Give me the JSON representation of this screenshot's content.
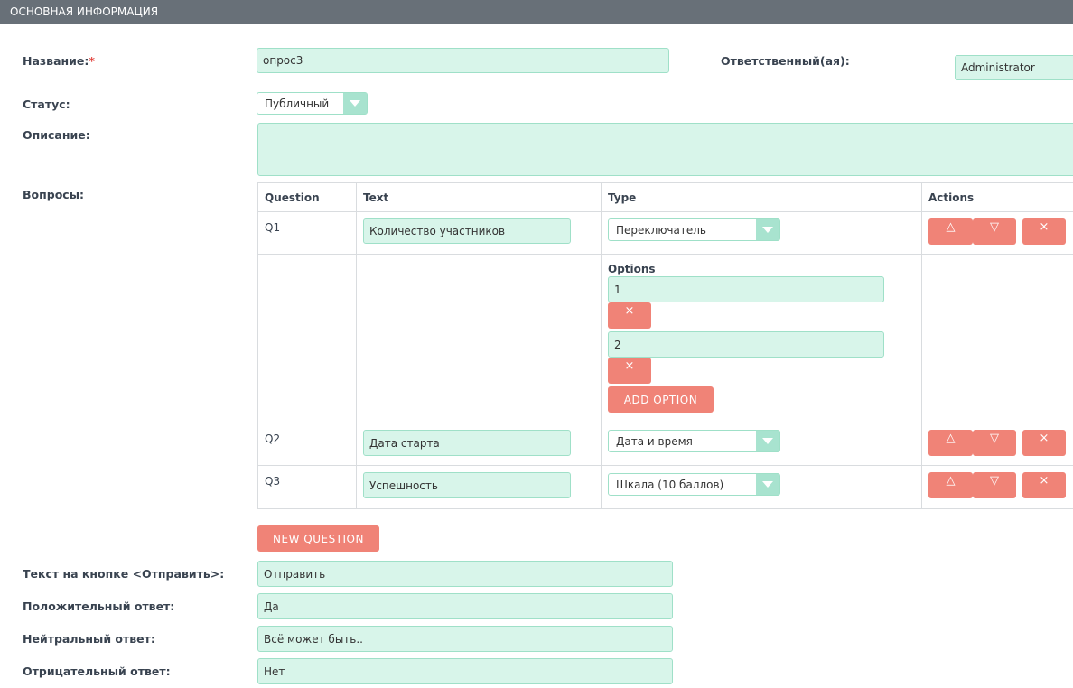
{
  "header": {
    "title": "ОСНОВНАЯ ИНФОРМАЦИЯ"
  },
  "form": {
    "name_label": "Название:",
    "required_mark": "*",
    "name_value": "опрос3",
    "assigned_label": "Ответственный(ая):",
    "assigned_value": "Administrator",
    "status_label": "Статус:",
    "status_value": "Публичный",
    "description_label": "Описание:",
    "description_value": "",
    "questions_label": "Вопросы:"
  },
  "questions_table": {
    "headers": {
      "question": "Question",
      "text": "Text",
      "type": "Type",
      "actions": "Actions"
    },
    "rows": [
      {
        "id": "Q1",
        "text": "Количество участников",
        "type": "Переключатель"
      },
      {
        "id": "Q2",
        "text": "Дата старта",
        "type": "Дата и время"
      },
      {
        "id": "Q3",
        "text": "Успешность",
        "type": "Шкала (10 баллов)"
      }
    ],
    "options_label": "Options",
    "options": [
      "1",
      "2"
    ],
    "add_option_label": "ADD OPTION",
    "action_icons": {
      "up": "△",
      "down": "▽",
      "remove": "×"
    }
  },
  "new_question_label": "NEW QUESTION",
  "extra": {
    "submit_label": "Текст на кнопке <Отправить>:",
    "submit_value": "Отправить",
    "positive_label": "Положительный ответ:",
    "positive_value": "Да",
    "neutral_label": "Нейтральный ответ:",
    "neutral_value": "Всё может быть..",
    "negative_label": "Отрицательный ответ:",
    "negative_value": "Нет"
  },
  "colors": {
    "header_bg": "#687078",
    "input_bg": "#d8f5ea",
    "input_border": "#9fe0c8",
    "button_red": "#f08377",
    "required": "#e2413b"
  }
}
